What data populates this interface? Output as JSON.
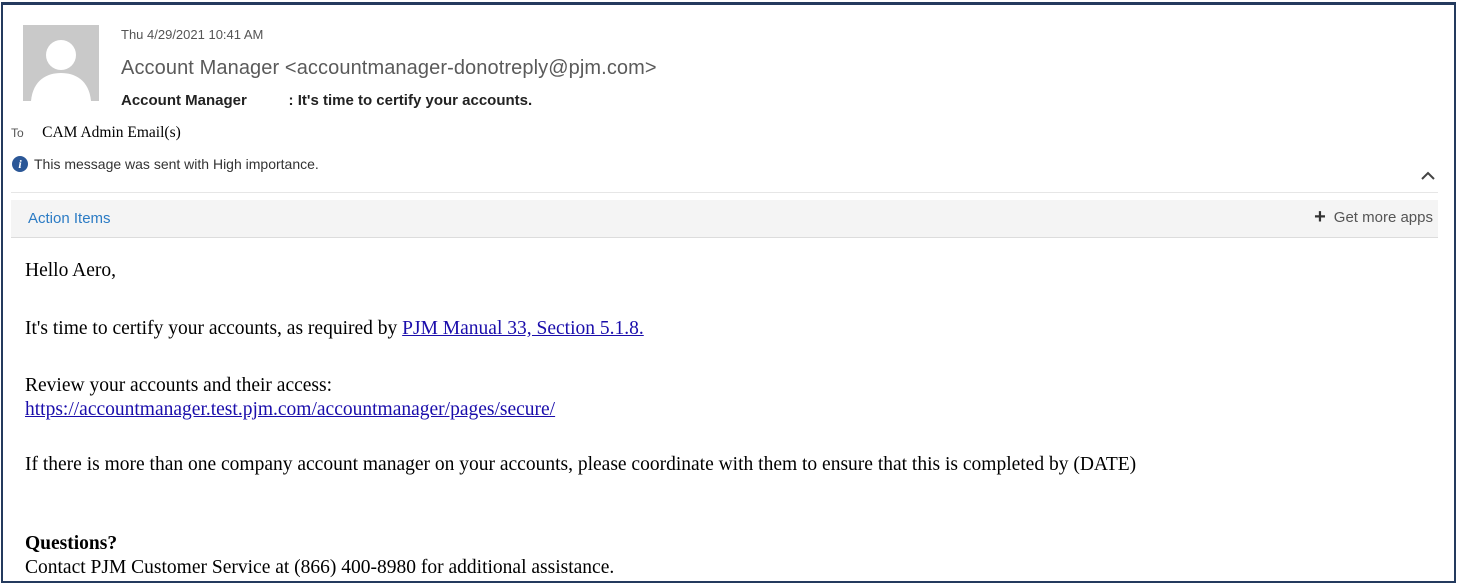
{
  "message": {
    "date": "Thu 4/29/2021 10:41 AM",
    "from": "Account Manager <accountmanager-donotreply@pjm.com>",
    "subject_sender": "Account Manager",
    "subject_text": ": It's time to certify your accounts.",
    "to_label": "To",
    "to_value": "CAM Admin Email(s)",
    "importance_notice": "This message was sent with High importance."
  },
  "action_bar": {
    "action_items_label": "Action Items",
    "get_more_apps_label": "Get more apps"
  },
  "body": {
    "greeting": "Hello Aero,",
    "certify_intro": "It's time to certify your accounts, as required by ",
    "manual_link": "PJM Manual 33, Section 5.1.8.",
    "review_text": "Review your accounts and their access:",
    "review_url": "https://accountmanager.test.pjm.com/accountmanager/pages/secure/",
    "coordinate_text": "If there is more than one company account manager on your accounts, please coordinate with them to ensure that this is completed by",
    "date_placeholder": "(DATE)",
    "questions_heading": "Questions?",
    "contact_text": "Contact PJM Customer Service at (866) 400-8980 for additional assistance."
  },
  "icons": {
    "avatar": "default-person-avatar",
    "info": "info-icon",
    "collapse": "chevron-up-icon",
    "add": "plus-icon"
  },
  "colors": {
    "link": "#1a0dab",
    "action_items": "#2b7bc4",
    "info_icon": "#2b5797",
    "frame_border": "#243a5e"
  }
}
